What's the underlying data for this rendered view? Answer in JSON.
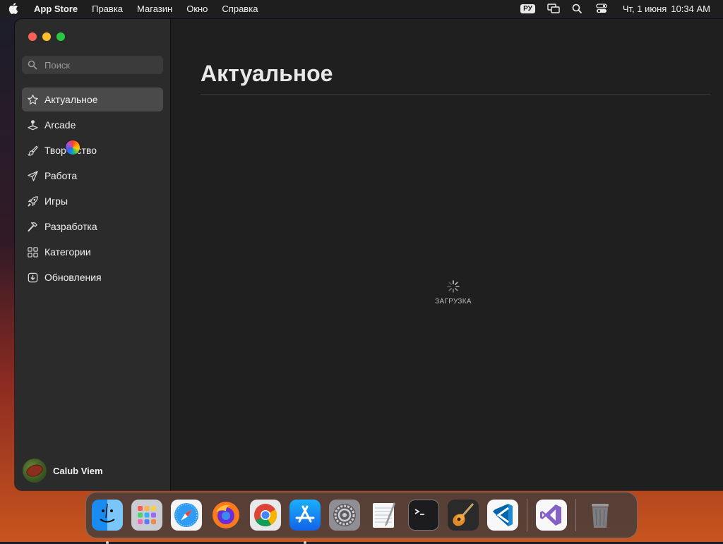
{
  "menubar": {
    "app_name": "App Store",
    "items": [
      "Правка",
      "Магазин",
      "Окно",
      "Справка"
    ],
    "input_source": "РУ",
    "date": "Чт, 1 июня",
    "time": "10:34 AM"
  },
  "sidebar": {
    "search_placeholder": "Поиск",
    "items": [
      {
        "label": "Актуальное",
        "icon": "star-icon",
        "active": true
      },
      {
        "label": "Arcade",
        "icon": "joystick-icon",
        "active": false
      },
      {
        "label": "Творчество",
        "icon": "brush-icon",
        "active": false
      },
      {
        "label": "Работа",
        "icon": "paper-plane-icon",
        "active": false
      },
      {
        "label": "Игры",
        "icon": "rocket-icon",
        "active": false
      },
      {
        "label": "Разработка",
        "icon": "hammer-icon",
        "active": false
      },
      {
        "label": "Категории",
        "icon": "grid-icon",
        "active": false
      },
      {
        "label": "Обновления",
        "icon": "download-icon",
        "active": false
      }
    ],
    "user": {
      "name": "Calub Viem"
    }
  },
  "main": {
    "title": "Актуальное",
    "loading_label": "ЗАГРУЗКА"
  },
  "dock": {
    "apps": [
      {
        "name": "Finder",
        "icon": "finder-icon",
        "running": true
      },
      {
        "name": "Launchpad",
        "icon": "launchpad-icon",
        "running": false
      },
      {
        "name": "Safari",
        "icon": "safari-icon",
        "running": false
      },
      {
        "name": "Firefox",
        "icon": "firefox-icon",
        "running": false
      },
      {
        "name": "Chrome",
        "icon": "chrome-icon",
        "running": false
      },
      {
        "name": "App Store",
        "icon": "app-store-icon",
        "running": true
      },
      {
        "name": "System Settings",
        "icon": "settings-icon",
        "running": false
      },
      {
        "name": "TextEdit",
        "icon": "textedit-icon",
        "running": false
      },
      {
        "name": "Terminal",
        "icon": "terminal-icon",
        "running": false
      },
      {
        "name": "GarageBand",
        "icon": "guitar-icon",
        "running": false
      },
      {
        "name": "VS Code",
        "icon": "vscode-icon",
        "running": false
      },
      {
        "name": "Visual Studio",
        "icon": "visual-studio-icon",
        "running": false
      },
      {
        "name": "Trash",
        "icon": "trash-icon",
        "running": false
      }
    ]
  },
  "colors": {
    "accent_red": "#fe5f57",
    "accent_yellow": "#febc2e",
    "accent_green": "#28c840",
    "sidebar_bg": "#2b2b2c",
    "content_bg": "#1f1f20"
  }
}
